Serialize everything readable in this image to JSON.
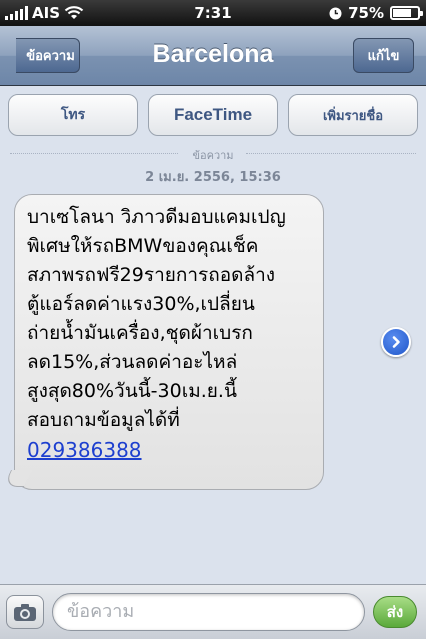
{
  "status_bar": {
    "carrier": "AIS",
    "time": "7:31",
    "battery": "75%",
    "battery_level": 0.75
  },
  "nav": {
    "back_label": "ข้อความ",
    "title": "Barcelona",
    "edit_label": "แก้ไข"
  },
  "actions": {
    "call_label": "โทร",
    "facetime_label": "FaceTime",
    "add_contact_label": "เพิ่มรายชื่อ"
  },
  "thread": {
    "separator_label": "ข้อความ",
    "timestamp": "2 เม.ย. 2556, 15:36"
  },
  "message": {
    "lines": [
      "บาเซโลนา วิภาวดีมอบแคมเปญ",
      "พิเศษให้รถBMWของคุณเช็ค",
      "สภาพรถฟรี29รายการถอดล้าง",
      "ตู้แอร์ลดค่าแรง30%,เปลี่ยน",
      "ถ่ายน้ำมันเครื่อง,ชุดผ้าเบรก",
      "ลด15%,ส่วนลดค่าอะไหล่",
      "สูงสุด80%วันนี้-30เม.ย.นี้",
      "สอบถามข้อมูลได้ที่"
    ],
    "phone_link": "029386388"
  },
  "input_bar": {
    "placeholder": "ข้อความ",
    "send_label": "ส่ง"
  },
  "icons": {
    "camera": "camera-icon",
    "disclosure": "chevron-right-circle-icon",
    "wifi": "wifi-icon",
    "clock": "clock-icon"
  }
}
